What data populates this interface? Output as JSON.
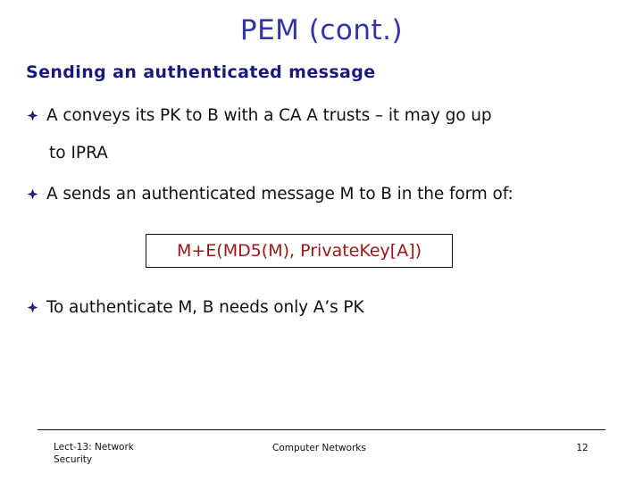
{
  "slide": {
    "title": "PEM (cont.)",
    "title_color": "#3333AA",
    "subtitle": "Sending an authenticated message",
    "subtitle_color": "#1A1A7A",
    "background_color": "#FFFFFF",
    "bullet_marker": "❯",
    "bullet_glyph_name": "diamond-bullet-icon",
    "bullet_color": "#1A1A6E",
    "bullets": [
      {
        "text": "A conveys its PK to B with a CA A trusts – it may go up",
        "continuation": "to IPRA"
      },
      {
        "text": "A sends an authenticated message M to B in the form of:"
      },
      {
        "text": "To authenticate M, B needs only A’s PK"
      }
    ],
    "formula": {
      "text": "M+E(MD5(M), PrivateKey[A])",
      "color": "#9B1717",
      "border_color": "#111111"
    },
    "footer": {
      "left_line1": "Lect-13: Network",
      "left_line2": "Security",
      "center": "Computer Networks",
      "page_number": "12"
    }
  }
}
